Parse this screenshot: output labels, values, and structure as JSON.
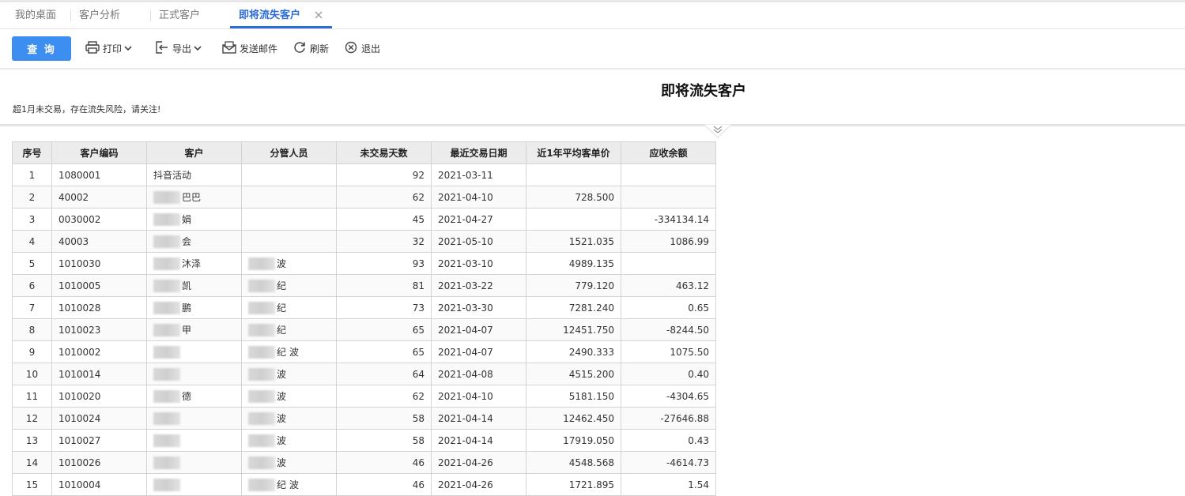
{
  "tabs": [
    {
      "label": "我的桌面",
      "active": false
    },
    {
      "label": "客户分析",
      "active": false
    },
    {
      "label": "正式客户",
      "active": false
    },
    {
      "label": "即将流失客户",
      "active": true
    }
  ],
  "toolbar": {
    "query_label": "查 询",
    "print_label": "打印",
    "export_label": "导出",
    "email_label": "发送邮件",
    "refresh_label": "刷新",
    "exit_label": "退出"
  },
  "report": {
    "title": "即将流失客户",
    "note": "超1月未交易，存在流失风险，请关注!"
  },
  "colors": {
    "accent": "#3c8ff0",
    "tab_active": "#2b6cd8",
    "negative": "#e2231a"
  },
  "table": {
    "headers": [
      "序号",
      "客户编码",
      "客户",
      "分管人员",
      "未交易天数",
      "最近交易日期",
      "近1年平均客单价",
      "应收余额"
    ],
    "rows": [
      {
        "no": "1",
        "code": "1080001",
        "customer": "抖音活动",
        "staff": "",
        "days": "92",
        "date": "2021-03-11",
        "avg": "",
        "balance": "",
        "neg": false
      },
      {
        "no": "2",
        "code": "40002",
        "customer": "巴巴",
        "staff": "",
        "days": "62",
        "date": "2021-04-10",
        "avg": "728.500",
        "balance": "",
        "neg": false
      },
      {
        "no": "3",
        "code": "0030002",
        "customer": "娟",
        "staff": "",
        "days": "45",
        "date": "2021-04-27",
        "avg": "",
        "balance": "-334134.14",
        "neg": true
      },
      {
        "no": "4",
        "code": "40003",
        "customer": "会",
        "staff": "",
        "days": "32",
        "date": "2021-05-10",
        "avg": "1521.035",
        "balance": "1086.99",
        "neg": false
      },
      {
        "no": "5",
        "code": "1010030",
        "customer": "沐泽",
        "staff": "波",
        "days": "93",
        "date": "2021-03-10",
        "avg": "4989.135",
        "balance": "",
        "neg": false
      },
      {
        "no": "6",
        "code": "1010005",
        "customer": "凯",
        "staff": "纪",
        "days": "81",
        "date": "2021-03-22",
        "avg": "779.120",
        "balance": "463.12",
        "neg": false
      },
      {
        "no": "7",
        "code": "1010028",
        "customer": "鹏",
        "staff": "纪",
        "days": "73",
        "date": "2021-03-30",
        "avg": "7281.240",
        "balance": "0.65",
        "neg": false
      },
      {
        "no": "8",
        "code": "1010023",
        "customer": "甲",
        "staff": "纪",
        "days": "65",
        "date": "2021-04-07",
        "avg": "12451.750",
        "balance": "-8244.50",
        "neg": true
      },
      {
        "no": "9",
        "code": "1010002",
        "customer": "",
        "staff": "纪 波",
        "days": "65",
        "date": "2021-04-07",
        "avg": "2490.333",
        "balance": "1075.50",
        "neg": false
      },
      {
        "no": "10",
        "code": "1010014",
        "customer": "",
        "staff": "波",
        "days": "64",
        "date": "2021-04-08",
        "avg": "4515.200",
        "balance": "0.40",
        "neg": false
      },
      {
        "no": "11",
        "code": "1010020",
        "customer": "德",
        "staff": "波",
        "days": "62",
        "date": "2021-04-10",
        "avg": "5181.150",
        "balance": "-4304.65",
        "neg": true
      },
      {
        "no": "12",
        "code": "1010024",
        "customer": "",
        "staff": "波",
        "days": "58",
        "date": "2021-04-14",
        "avg": "12462.450",
        "balance": "-27646.88",
        "neg": true
      },
      {
        "no": "13",
        "code": "1010027",
        "customer": "",
        "staff": "波",
        "days": "58",
        "date": "2021-04-14",
        "avg": "17919.050",
        "balance": "0.43",
        "neg": false
      },
      {
        "no": "14",
        "code": "1010026",
        "customer": "",
        "staff": "波",
        "days": "46",
        "date": "2021-04-26",
        "avg": "4548.568",
        "balance": "-4614.73",
        "neg": true
      },
      {
        "no": "15",
        "code": "1010004",
        "customer": "",
        "staff": "纪 波",
        "days": "46",
        "date": "2021-04-26",
        "avg": "1721.895",
        "balance": "1.54",
        "neg": false
      }
    ]
  }
}
